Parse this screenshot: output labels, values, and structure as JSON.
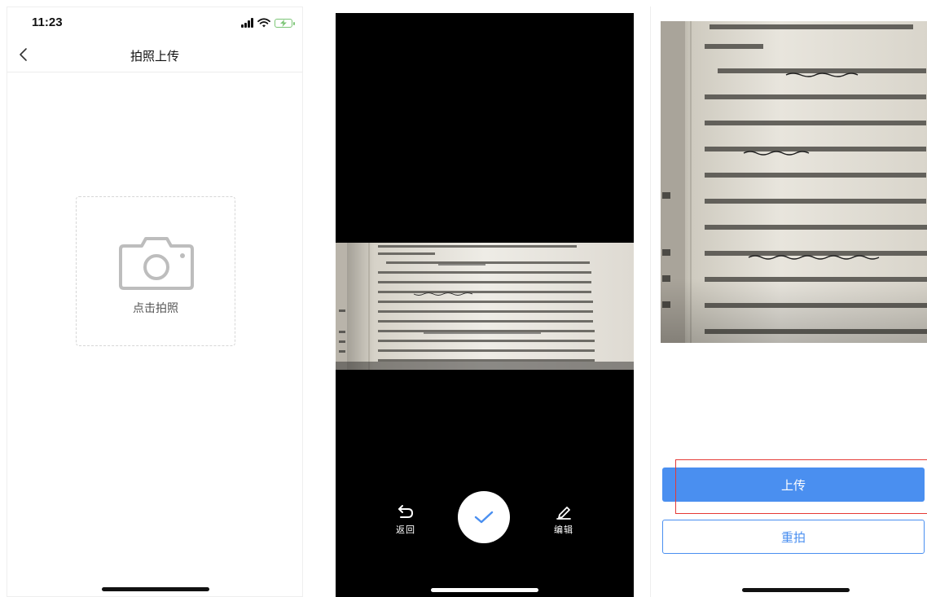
{
  "screen1": {
    "status_time": "11:23",
    "title": "拍照上传",
    "capture_label": "点击拍照"
  },
  "screen2": {
    "return_label": "返回",
    "edit_label": "编辑"
  },
  "screen3": {
    "upload_label": "上传",
    "retake_label": "重拍"
  },
  "icons": {
    "back": "chevron-left-icon",
    "camera": "camera-icon",
    "return": "undo-arrow-icon",
    "confirm": "checkmark-icon",
    "edit": "pencil-icon"
  },
  "colors": {
    "accent_blue": "#4a8ff0",
    "highlight_red": "#e53935",
    "battery_green": "#7cc576",
    "camera_background": "#000000"
  }
}
